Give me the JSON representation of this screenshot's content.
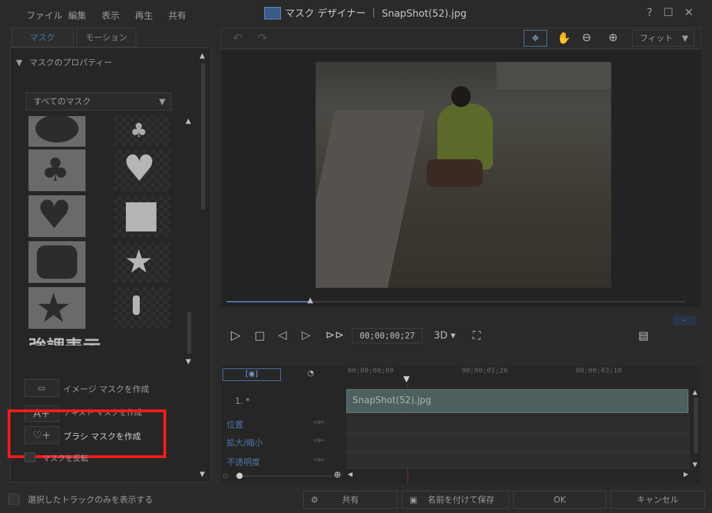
{
  "window": {
    "title": "マスク デザイナー ｜ SnapShot(52).jpg",
    "help": "?",
    "maximize": "☐",
    "close": "✕"
  },
  "menu": [
    "ファイル",
    "編集",
    "表示",
    "再生",
    "共有"
  ],
  "tabs": {
    "mask": "マスク",
    "motion": "モーション"
  },
  "properties": {
    "header": "マスクのプロパティー",
    "dropdown_value": "すべてのマスク",
    "text_mask_sample": "強調表示"
  },
  "actions": {
    "image_mask": "イメージ マスクを作成",
    "text_mask": "テキスト マスクを作成",
    "brush_mask": "ブラシ マスクを作成",
    "invert_mask": "マスクを反転"
  },
  "viewer": {
    "zoom": "フィット",
    "timecode": "00;00;00;27",
    "mode3d": "3D"
  },
  "timeline": {
    "ruler": [
      "00;00;00;00",
      "00;00;01;20",
      "00;00;03;10"
    ],
    "track_label": "1. *",
    "clip_name": "SnapShot(52).jpg",
    "properties": [
      "位置",
      "拡大/縮小",
      "不透明度"
    ]
  },
  "footer": {
    "checkbox_label": "選択したトラックのみを表示する",
    "share": "共有",
    "save_as": "名前を付けて保存",
    "ok": "OK",
    "cancel": "キャンセル"
  },
  "colors": {
    "highlight": "#ff1a1a",
    "accent": "#4f76a8",
    "clip": "#4d5f5e"
  }
}
